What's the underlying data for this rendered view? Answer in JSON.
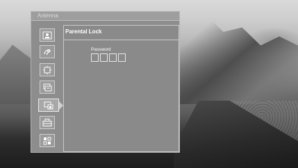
{
  "osd": {
    "window_title": "Antenna",
    "panel_title": "Parental Lock",
    "password_label": "Password",
    "password_digits": [
      "",
      "",
      "",
      ""
    ]
  },
  "sidebar": {
    "items": [
      {
        "icon": "picture-icon",
        "active": false
      },
      {
        "icon": "sound-icon",
        "active": false
      },
      {
        "icon": "channel-icon",
        "active": false
      },
      {
        "icon": "timer-icon",
        "active": false
      },
      {
        "icon": "lock-icon",
        "active": true
      },
      {
        "icon": "setup-icon",
        "active": false
      },
      {
        "icon": "input-icon",
        "active": false
      }
    ]
  }
}
